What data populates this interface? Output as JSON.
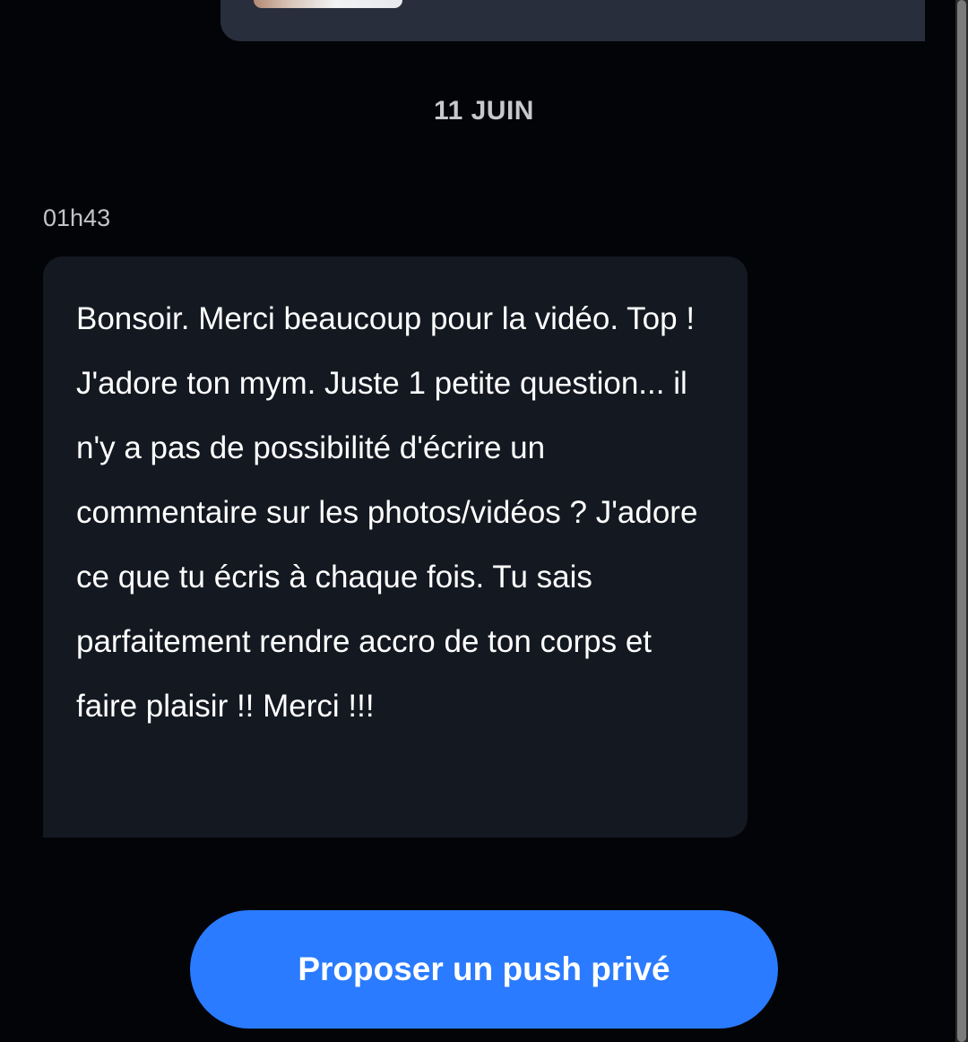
{
  "conversation": {
    "date_separator": "11 JUIN",
    "messages": [
      {
        "time": "01h43",
        "direction": "incoming",
        "text": "Bonsoir. Merci beaucoup pour la vidéo. Top ! J'adore ton mym. Juste 1 petite question... il n'y a pas de possibilité d'écrire un commentaire sur les photos/vidéos ? J'adore ce que tu écris à chaque fois. Tu sais parfaitement rendre accro de ton corps et faire plaisir !! Merci !!!"
      }
    ]
  },
  "actions": {
    "push_button_label": "Proposer un push privé"
  },
  "colors": {
    "background": "#030407",
    "incoming_bubble": "#141821",
    "outgoing_bubble": "#282e3b",
    "accent": "#2a7bff",
    "secondary_text": "#c2c4c8"
  }
}
